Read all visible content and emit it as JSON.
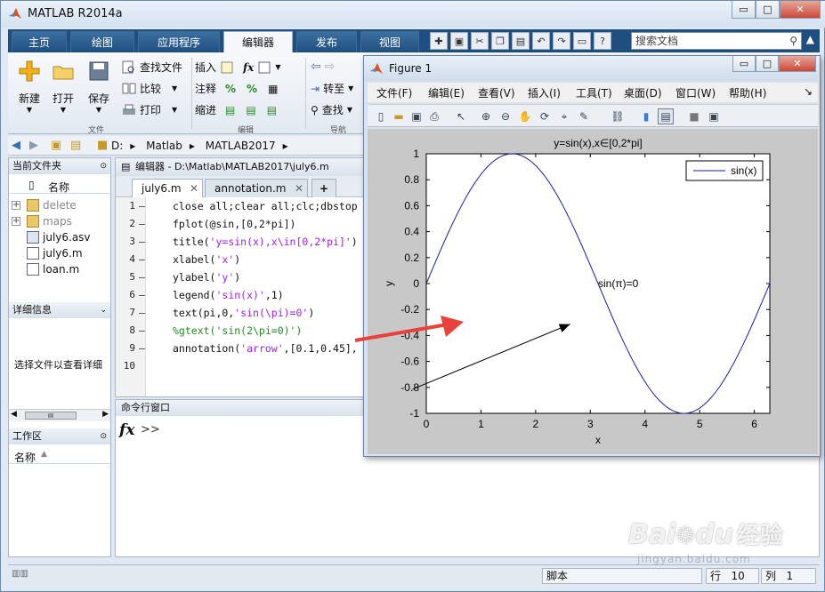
{
  "app": {
    "title": "MATLAB R2014a"
  },
  "window_controls": {
    "minimize": "▭",
    "maximize": "□",
    "close": "✕"
  },
  "tabs": [
    {
      "label": "主页",
      "active": false
    },
    {
      "label": "绘图",
      "active": false
    },
    {
      "label": "应用程序",
      "active": false
    },
    {
      "label": "编辑器",
      "active": true
    },
    {
      "label": "发布",
      "active": false
    },
    {
      "label": "视图",
      "active": false
    }
  ],
  "quick_access": [
    "new-icon",
    "save-icon",
    "cut-icon",
    "copy-icon",
    "paste-icon",
    "undo-icon",
    "redo-icon",
    "switch-window-icon",
    "help-icon"
  ],
  "search": {
    "placeholder": "搜索文档"
  },
  "ribbon": {
    "new_label": "新建",
    "open_label": "打开",
    "save_label": "保存",
    "find_files": "查找文件",
    "compare": "比较",
    "print": "打印",
    "insert": "插入",
    "comment": "注释",
    "indent": "缩进",
    "goto": "转至",
    "find": "查找",
    "group_file": "文件",
    "group_edit": "编辑",
    "group_nav": "导航",
    "fx": "fx"
  },
  "address": {
    "crumbs": [
      "D:",
      "Matlab",
      "MATLAB2017"
    ]
  },
  "current_folder": {
    "title": "当前文件夹",
    "col_name": "名称",
    "items": [
      {
        "name": "delete",
        "type": "folder"
      },
      {
        "name": "maps",
        "type": "folder"
      },
      {
        "name": "july6.asv",
        "type": "file"
      },
      {
        "name": "july6.m",
        "type": "file"
      },
      {
        "name": "loan.m",
        "type": "file"
      }
    ]
  },
  "details": {
    "title": "详细信息",
    "hint": "选择文件以查看详细"
  },
  "scroll_label": "III",
  "workspace": {
    "title": "工作区",
    "col_name": "名称"
  },
  "editor": {
    "path": "编辑器 - D:\\Matlab\\MATLAB2017\\july6.m",
    "tabs": [
      {
        "label": "july6.m",
        "active": true
      },
      {
        "label": "annotation.m",
        "active": false
      }
    ],
    "add_tab": "+",
    "lines": [
      {
        "n": "1",
        "code": "close all;clear all;clc;dbstop"
      },
      {
        "n": "2",
        "code": "fplot(@sin,[0,2*pi])"
      },
      {
        "n": "3",
        "code": "title('y=sin(x),x\\in[0,2*pi]')"
      },
      {
        "n": "4",
        "code": "xlabel('x')"
      },
      {
        "n": "5",
        "code": "ylabel('y')"
      },
      {
        "n": "6",
        "code": "legend('sin(x)',1)"
      },
      {
        "n": "7",
        "code": "text(pi,0,'sin(\\pi)=0')"
      },
      {
        "n": "8",
        "code": "%gtext('sin(2\\pi=0)')"
      },
      {
        "n": "9",
        "code": "annotation('arrow',[0.1,0.45],"
      },
      {
        "n": "10",
        "code": ""
      }
    ]
  },
  "command_window": {
    "title": "命令行窗口",
    "fx": "fx",
    "prompt": ">>"
  },
  "status": {
    "mode": "脚本",
    "row_label": "行",
    "row": "10",
    "col_label": "列",
    "col": "1"
  },
  "figure": {
    "title": "Figure 1",
    "menu": [
      "文件(F)",
      "编辑(E)",
      "查看(V)",
      "插入(I)",
      "工具(T)",
      "桌面(D)",
      "窗口(W)",
      "帮助(H)"
    ],
    "menu_arrow": "↘",
    "toolbar": [
      "new-figure-icon",
      "open-icon",
      "save-icon",
      "print-icon",
      "pointer-icon",
      "zoom-in-icon",
      "zoom-out-icon",
      "pan-icon",
      "rotate-icon",
      "data-cursor-icon",
      "brush-icon",
      "link-icon",
      "colorbar-icon",
      "legend-icon",
      "hide-plot-tools-icon",
      "show-plot-tools-icon"
    ]
  },
  "chart_data": {
    "type": "line",
    "title": "y=sin(x),x∈[0,2*pi]",
    "xlabel": "x",
    "ylabel": "y",
    "xlim": [
      0,
      6.2832
    ],
    "ylim": [
      -1,
      1
    ],
    "xticks": [
      "0",
      "1",
      "2",
      "3",
      "4",
      "5",
      "6"
    ],
    "yticks": [
      "-1",
      "-0.8",
      "-0.6",
      "-0.4",
      "-0.2",
      "0",
      "0.2",
      "0.4",
      "0.6",
      "0.8",
      "1"
    ],
    "series": [
      {
        "name": "sin(x)",
        "function": "sin",
        "color": "#1a1aa8"
      }
    ],
    "legend_position": "top-right",
    "annotation_text": "sin(π)=0",
    "annotation_text_x": 3.1416,
    "annotation_text_y": 0,
    "annotation_arrow": {
      "x": [
        0.1,
        0.45
      ],
      "y": [
        0.2,
        0.4
      ]
    },
    "grid": false
  },
  "overlay": {
    "arrow_color": "#e8423a"
  },
  "watermark": {
    "brand": "Bai",
    "brand2": "du",
    "cn": "经验",
    "url": "jingyan.baidu.com"
  }
}
